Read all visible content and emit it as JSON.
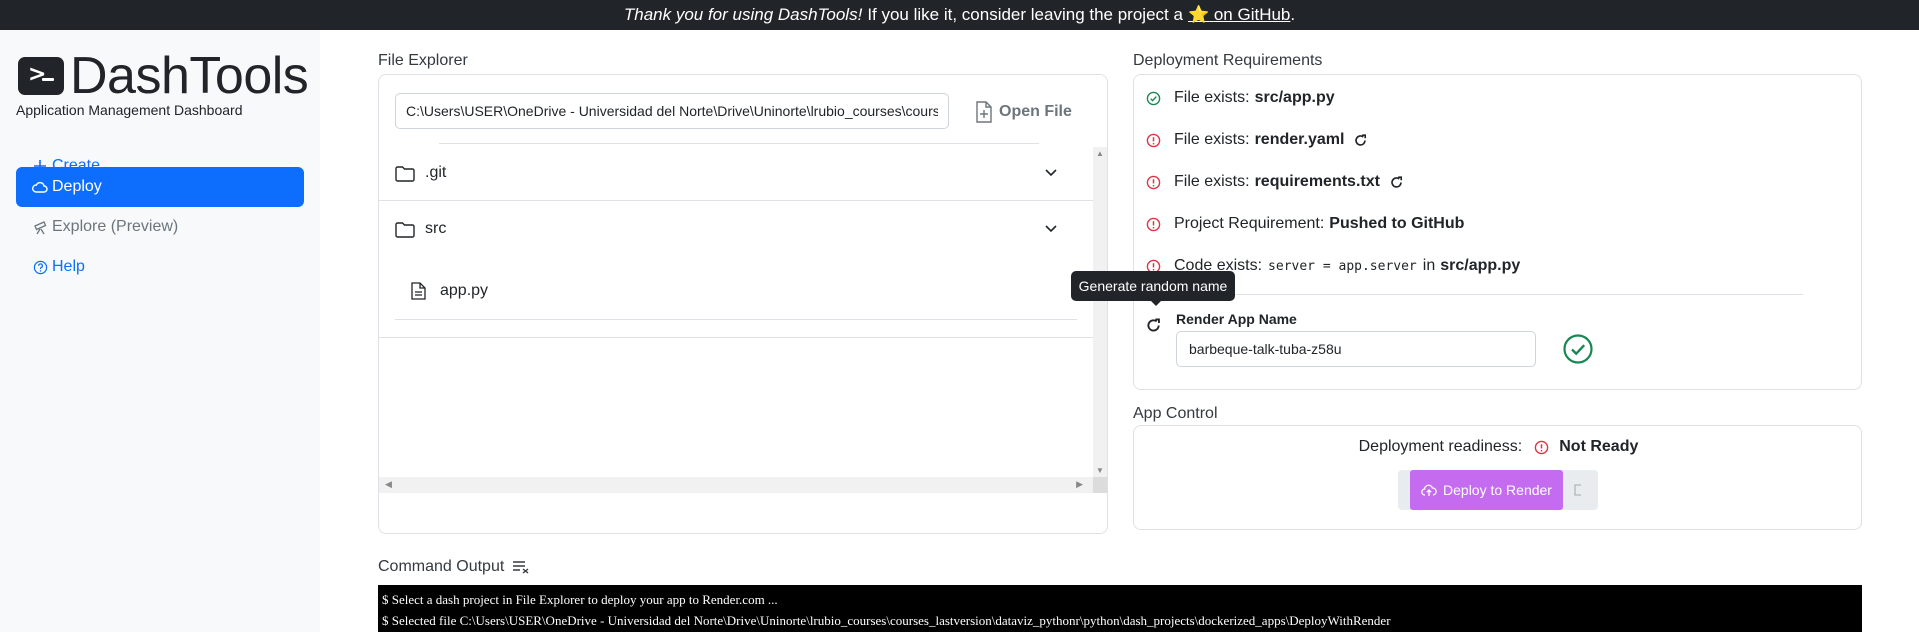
{
  "banner": {
    "thanks": "Thank you for using DashTools!",
    "message": "If you like it, consider leaving the project a",
    "star": "⭐",
    "link_text": "on GitHub",
    "period": "."
  },
  "sidebar": {
    "title": "DashTools",
    "subtitle": "Application Management Dashboard",
    "items": [
      {
        "label": "Create",
        "icon": "plus-icon"
      },
      {
        "label": "Deploy",
        "icon": "cloud-icon",
        "active": true
      },
      {
        "label": "Explore (Preview)",
        "icon": "telescope-icon"
      },
      {
        "label": "Help",
        "icon": "question-circle-icon"
      }
    ]
  },
  "file_explorer": {
    "title": "File Explorer",
    "path_value": "C:\\Users\\USER\\OneDrive - Universidad del Norte\\Drive\\Uninorte\\lrubio_courses\\courses_lastversion\\dataviz_pythonr\\python\\dash_projects\\dockerized_apps\\DeployWithRender",
    "open_file_label": "Open File",
    "tree": [
      {
        "name": ".git",
        "type": "folder"
      },
      {
        "name": "src",
        "type": "folder",
        "children": [
          {
            "name": "app.py",
            "type": "file"
          }
        ]
      }
    ]
  },
  "requirements": {
    "title": "Deployment Requirements",
    "items": [
      {
        "prefix": "File exists:",
        "target": "src/app.py",
        "status": "ok"
      },
      {
        "prefix": "File exists:",
        "target": "render.yaml",
        "status": "error",
        "refresh": true
      },
      {
        "prefix": "File exists:",
        "target": "requirements.txt",
        "status": "error",
        "refresh": true
      },
      {
        "prefix": "Project Requirement:",
        "target": "Pushed to GitHub",
        "status": "error"
      },
      {
        "prefix": "Code exists:",
        "code": "server = app.server",
        "connector": "in",
        "target": "src/app.py",
        "status": "error"
      }
    ],
    "tooltip": "Generate random name",
    "app_name_label": "Render App Name",
    "app_name_value": "barbeque-talk-tuba-z58u"
  },
  "app_control": {
    "title": "App Control",
    "readiness_label": "Deployment readiness:",
    "readiness_value": "Not Ready",
    "deploy_label": "Deploy to Render"
  },
  "command_output": {
    "title": "Command Output",
    "lines": [
      "$ Select a dash project in File Explorer to deploy your app to Render.com ...",
      "$ Selected file C:\\Users\\USER\\OneDrive - Universidad del Norte\\Drive\\Uninorte\\lrubio_courses\\courses_lastversion\\dataviz_pythonr\\python\\dash_projects\\dockerized_apps\\DeployWithRender"
    ]
  },
  "colors": {
    "primary": "#0d6efd",
    "success": "#198754",
    "danger": "#dc3545",
    "deploy": "#c56bf0",
    "banner_bg": "#212529"
  }
}
